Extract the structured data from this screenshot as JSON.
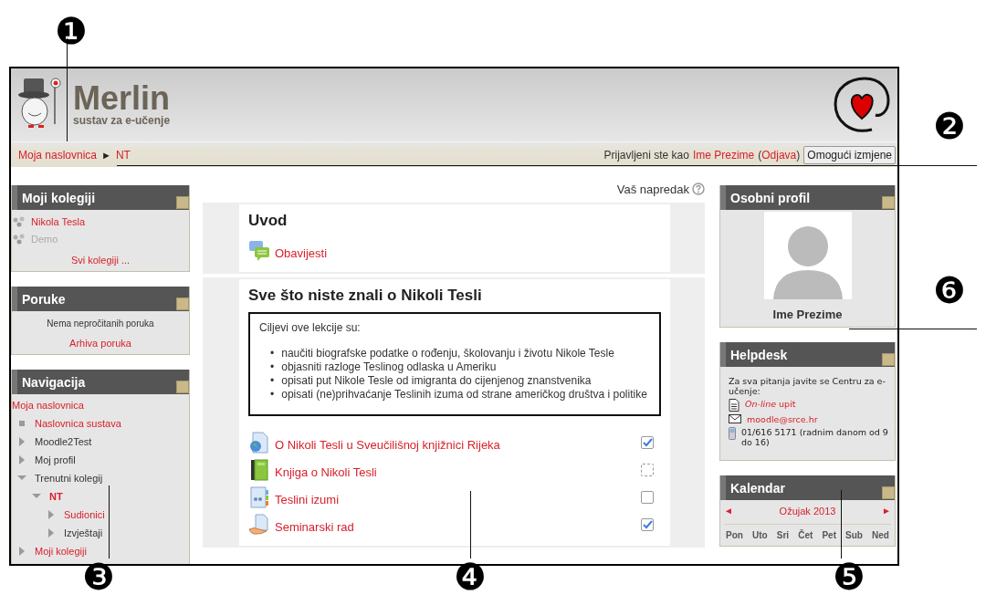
{
  "header": {
    "site_name": "Merlin",
    "tagline": "sustav za e-učenje"
  },
  "breadcrumb": {
    "separator": "►",
    "items": [
      {
        "label": "Moja naslovnica"
      },
      {
        "label": "NT"
      }
    ]
  },
  "login": {
    "prefix": "Prijavljeni ste kao",
    "user": "Ime Prezime",
    "open": "(",
    "logout": "Odjava",
    "close": ")",
    "button": "Omogući izmjene"
  },
  "my_courses": {
    "title": "Moji kolegiji",
    "courses": [
      {
        "name": "Nikola Tesla",
        "visible": true
      },
      {
        "name": "Demo",
        "visible": false
      }
    ],
    "all_link": "Svi kolegiji ..."
  },
  "messages": {
    "title": "Poruke",
    "text": "Nema nepročitanih poruka",
    "link": "Arhiva poruka"
  },
  "navigation": {
    "title": "Navigacija",
    "items": [
      {
        "label": "Moja naslovnica",
        "kind": "root",
        "link": true,
        "active": false
      },
      {
        "label": "Naslovnica sustava",
        "kind": "page",
        "link": true,
        "active": false
      },
      {
        "label": "Moodle2Test",
        "kind": "branch",
        "expanded": false,
        "link": false,
        "active": false
      },
      {
        "label": "Moj profil",
        "kind": "branch",
        "expanded": false,
        "link": false,
        "active": false
      },
      {
        "label": "Trenutni kolegij",
        "kind": "branch",
        "expanded": true,
        "link": false,
        "active": false,
        "children": [
          {
            "label": "NT",
            "kind": "branch",
            "expanded": true,
            "link": true,
            "active": true,
            "children": [
              {
                "label": "Sudionici",
                "kind": "branch",
                "expanded": false,
                "link": true,
                "active": false
              },
              {
                "label": "Izvještaji",
                "kind": "branch",
                "expanded": false,
                "link": false,
                "active": false
              }
            ]
          }
        ]
      },
      {
        "label": "Moji kolegiji",
        "kind": "branch",
        "expanded": false,
        "link": true,
        "active": false
      }
    ]
  },
  "progress_label": "Vaš napredak",
  "sections": [
    {
      "title": "Uvod",
      "activities": [
        {
          "kind": "forum",
          "name": "Obavijesti"
        }
      ]
    },
    {
      "title": "Sve što niste znali o Nikoli Tesli",
      "summary": {
        "intro": "Ciljevi ove lekcije su:",
        "marker": "•",
        "bullets": [
          "naučiti biografske podatke o rođenju, školovanju i životu Nikole Tesle",
          "objasniti razloge Teslinog odlaska u Ameriku",
          "opisati put Nikole Tesle od imigranta do cijenjenog znanstvenika",
          "opisati (ne)prihvaćanje Teslinih izuma od strane američkog društva i politike"
        ]
      },
      "activities": [
        {
          "kind": "url",
          "name": "O Nikoli Tesli u Sveučilišnoj knjižnici Rijeka",
          "completion": {
            "kind": "manual",
            "checked": true
          }
        },
        {
          "kind": "book",
          "name": "Knjiga o Nikoli Tesli",
          "completion": {
            "kind": "auto",
            "checked": false
          }
        },
        {
          "kind": "glossary",
          "name": "Teslini izumi",
          "completion": {
            "kind": "manual",
            "checked": false
          }
        },
        {
          "kind": "assignment",
          "name": "Seminarski rad",
          "completion": {
            "kind": "manual",
            "checked": true
          }
        }
      ]
    }
  ],
  "profile": {
    "title": "Osobni profil",
    "name": "Ime Prezime"
  },
  "helpdesk": {
    "title": "Helpdesk",
    "intro": "Za sva pitanja javite se Centru za e-učenje:",
    "contacts": [
      {
        "kind": "form",
        "text": "*On-line* upit",
        "link": true
      },
      {
        "kind": "mail",
        "text": "moodle@srce.hr",
        "link": true
      },
      {
        "kind": "phone",
        "text": "01/616 5171 (radnim danom od 9 do 16)",
        "link": false
      }
    ]
  },
  "calendar": {
    "title": "Kalendar",
    "prev": "◄",
    "month": "Ožujak 2013",
    "next": "►",
    "days": [
      "Pon",
      "Uto",
      "Sri",
      "Čet",
      "Pet",
      "Sub",
      "Ned"
    ]
  },
  "callouts": [
    "❶",
    "❷",
    "❸",
    "❹",
    "❺",
    "❻"
  ]
}
